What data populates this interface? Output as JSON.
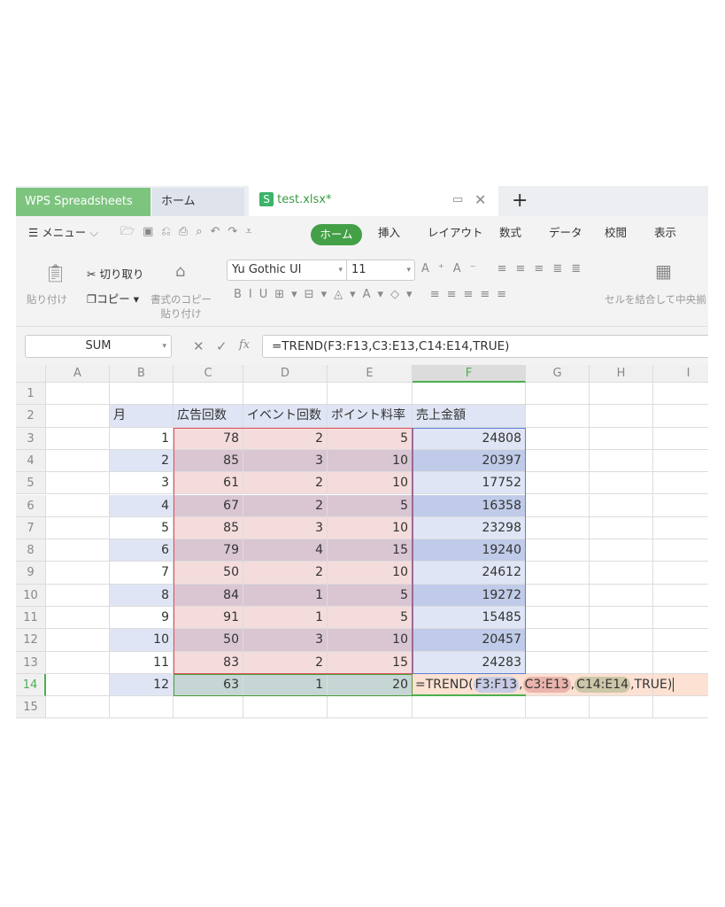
{
  "tabs": {
    "app": "WPS Spreadsheets",
    "home": "ホーム",
    "file": "test.xlsx*",
    "file_icon": "S",
    "new": "+"
  },
  "menu": {
    "menu_label": "メニュー",
    "items": [
      "ホーム",
      "挿入",
      "レイアウト",
      "数式",
      "データ",
      "校閲",
      "表示"
    ],
    "active": "ホーム"
  },
  "ribbon": {
    "paste": "貼り付け",
    "cut": "切り取り",
    "copy": "コピー",
    "format_painter": "書式のコピー",
    "format_painter2": "貼り付け",
    "font": "Yu Gothic UI",
    "size": "11",
    "merge": "セルを結合して中央揃"
  },
  "formula_bar": {
    "name_box": "SUM",
    "fx": "fx",
    "formula": "=TREND(F3:F13,C3:E13,C14:E14,TRUE)"
  },
  "columns": [
    "A",
    "B",
    "C",
    "D",
    "E",
    "F",
    "G",
    "H",
    "I"
  ],
  "rows": [
    "1",
    "2",
    "3",
    "4",
    "5",
    "6",
    "7",
    "8",
    "9",
    "10",
    "11",
    "12",
    "13",
    "14",
    "15"
  ],
  "headers": [
    "月",
    "広告回数",
    "イベント回数",
    "ポイント料率",
    "売上金額"
  ],
  "table": [
    [
      1,
      78,
      2,
      5,
      24808
    ],
    [
      2,
      85,
      3,
      10,
      20397
    ],
    [
      3,
      61,
      2,
      10,
      17752
    ],
    [
      4,
      67,
      2,
      5,
      16358
    ],
    [
      5,
      85,
      3,
      10,
      23298
    ],
    [
      6,
      79,
      4,
      15,
      19240
    ],
    [
      7,
      50,
      2,
      10,
      24612
    ],
    [
      8,
      84,
      1,
      5,
      19272
    ],
    [
      9,
      91,
      1,
      5,
      15485
    ],
    [
      10,
      50,
      3,
      10,
      20457
    ],
    [
      11,
      83,
      2,
      15,
      24283
    ]
  ],
  "row14": {
    "month": "12",
    "c": "63",
    "d": "1",
    "e": "20",
    "f_prefix": "=TREND(",
    "f_arg1": "F3:F13",
    "comma1": ",",
    "f_arg2": "C3:E13",
    "comma2": ",",
    "f_arg3": "C14:E14",
    "f_suffix": ",TRUE)"
  },
  "colors": {
    "accent": "#4caf50",
    "pink": "#f5dcdc",
    "mauve": "#d9c6d2",
    "blue_light": "#dfe5f4",
    "blue_dark": "#bfcbe8",
    "row14_green": "#c5d6d4",
    "row14_peach": "#fde1d2"
  }
}
